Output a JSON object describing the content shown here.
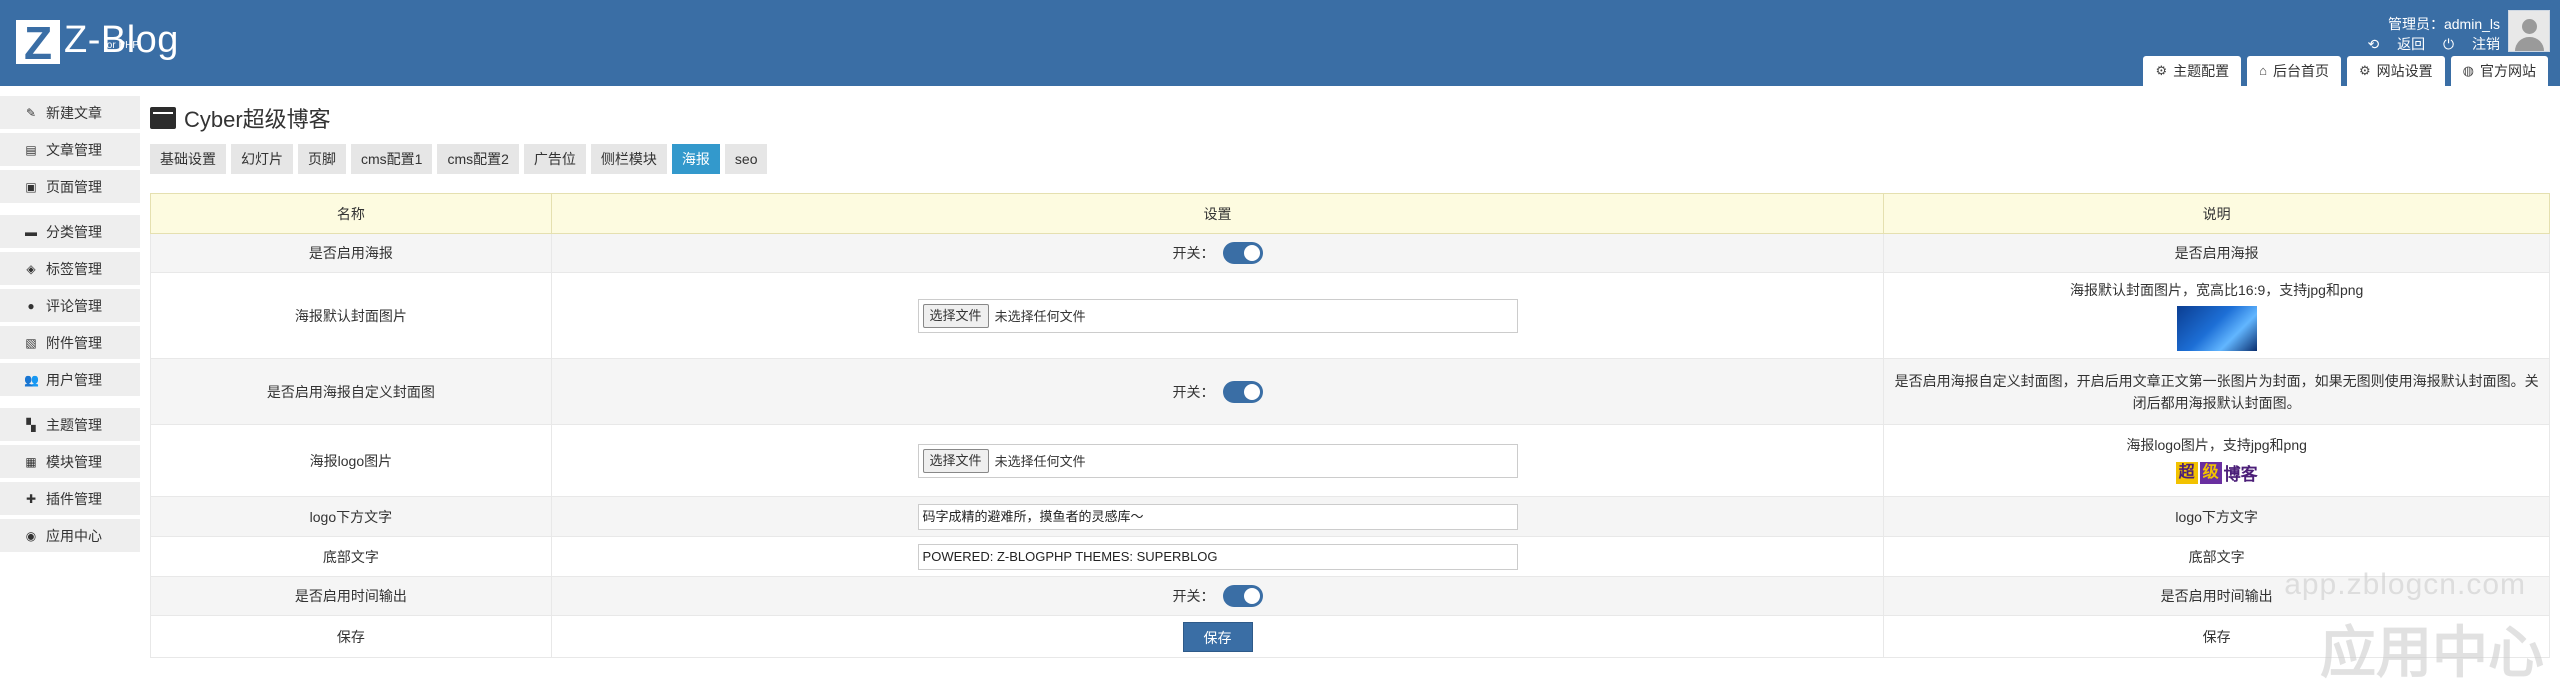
{
  "header": {
    "logo_text": "Z-Blog",
    "logo_sub": "for PHP",
    "admin_label": "管理员：admin_ls",
    "back_link": "返回",
    "logout_link": "注销",
    "top_tabs": [
      {
        "label": "主题配置",
        "icon": "gear-icon"
      },
      {
        "label": "后台首页",
        "icon": "home-icon"
      },
      {
        "label": "网站设置",
        "icon": "gear-icon"
      },
      {
        "label": "官方网站",
        "icon": "globe-icon"
      }
    ]
  },
  "sidebar": {
    "items": [
      {
        "label": "新建文章",
        "icon": "edit-icon"
      },
      {
        "label": "文章管理",
        "icon": "article-icon"
      },
      {
        "label": "页面管理",
        "icon": "page-icon"
      },
      {
        "label": "分类管理",
        "icon": "folder-icon"
      },
      {
        "label": "标签管理",
        "icon": "tag-icon"
      },
      {
        "label": "评论管理",
        "icon": "comment-icon"
      },
      {
        "label": "附件管理",
        "icon": "attachment-icon"
      },
      {
        "label": "用户管理",
        "icon": "users-icon"
      },
      {
        "label": "主题管理",
        "icon": "theme-icon"
      },
      {
        "label": "模块管理",
        "icon": "grid-icon"
      },
      {
        "label": "插件管理",
        "icon": "puzzle-icon"
      },
      {
        "label": "应用中心",
        "icon": "app-center-icon"
      }
    ]
  },
  "main": {
    "title": "Cyber超级博客",
    "tabs": [
      {
        "label": "基础设置",
        "active": false
      },
      {
        "label": "幻灯片",
        "active": false
      },
      {
        "label": "页脚",
        "active": false
      },
      {
        "label": "cms配置1",
        "active": false
      },
      {
        "label": "cms配置2",
        "active": false
      },
      {
        "label": "广告位",
        "active": false
      },
      {
        "label": "侧栏模块",
        "active": false
      },
      {
        "label": "海报",
        "active": true
      },
      {
        "label": "seo",
        "active": false
      }
    ],
    "table": {
      "headers": {
        "name": "名称",
        "setting": "设置",
        "desc": "说明"
      },
      "switch_label": "开关：",
      "file_button": "选择文件",
      "file_status": "未选择任何文件",
      "rows": {
        "enable_poster": {
          "name": "是否启用海报",
          "desc": "是否启用海报",
          "enabled": true
        },
        "cover_image": {
          "name": "海报默认封面图片",
          "desc": "海报默认封面图片，宽高比16:9，支持jpg和png"
        },
        "custom_cover": {
          "name": "是否启用海报自定义封面图",
          "desc": "是否启用海报自定义封面图，开启后用文章正文第一张图片为封面，如果无图则使用海报默认封面图。关闭后都用海报默认封面图。",
          "enabled": true
        },
        "logo_image": {
          "name": "海报logo图片",
          "desc": "海报logo图片，支持jpg和png",
          "logo_glyphs": [
            "超",
            "级",
            "博客"
          ]
        },
        "logo_text": {
          "name": "logo下方文字",
          "value": "码字成精的避难所，摸鱼者的灵感库～",
          "desc": "logo下方文字"
        },
        "footer_text": {
          "name": "底部文字",
          "value": "POWERED: Z-BLOGPHP THEMES: SUPERBLOG",
          "desc": "底部文字"
        },
        "time_output": {
          "name": "是否启用时间输出",
          "desc": "是否启用时间输出",
          "enabled": true
        },
        "save": {
          "name": "保存",
          "button": "保存",
          "desc": "保存"
        }
      }
    }
  },
  "watermark": {
    "url": "app.zblogcn.com",
    "text": "应用中心"
  },
  "colors": {
    "brand": "#3a6ea5",
    "active_tab": "#3399cc",
    "header_row": "#fdfbe0"
  }
}
